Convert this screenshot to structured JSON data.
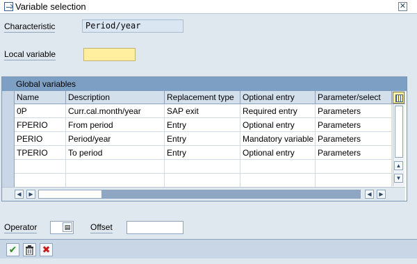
{
  "window": {
    "title": "Variable selection",
    "close_glyph": "✕"
  },
  "characteristic": {
    "label": "Characteristic",
    "value": "Period/year"
  },
  "local_variable": {
    "label": "Local variable",
    "value": ""
  },
  "global_variables": {
    "caption": "Global variables",
    "columns": [
      "Name",
      "Description",
      "Replacement type",
      "Optional entry",
      "Parameter/select"
    ],
    "rows": [
      [
        "0P",
        "Curr.cal.month/year",
        "SAP exit",
        "Required entry",
        "Parameters"
      ],
      [
        "FPERIO",
        "From period",
        "Entry",
        "Optional entry",
        "Parameters"
      ],
      [
        "PERIO",
        "Period/year",
        "Entry",
        "Mandatory variable ent",
        "Parameters"
      ],
      [
        "TPERIO",
        "To period",
        "Entry",
        "Optional entry",
        "Parameters"
      ],
      [
        "",
        "",
        "",
        "",
        ""
      ],
      [
        "",
        "",
        "",
        "",
        ""
      ]
    ]
  },
  "operator": {
    "label": "Operator",
    "value": ""
  },
  "offset": {
    "label": "Offset",
    "value": ""
  },
  "icons": {
    "confirm": "check-icon",
    "delete": "trash-icon",
    "cancel": "cancel-icon",
    "settings": "table-settings-icon"
  },
  "colors": {
    "caption_bg": "#7e9fc4",
    "header_bg": "#d4dfec",
    "required_input": "#ffef9f",
    "panel_bg": "#dfe7ef",
    "confirm_green": "#2e8b20",
    "cancel_red": "#cc1a1a"
  }
}
